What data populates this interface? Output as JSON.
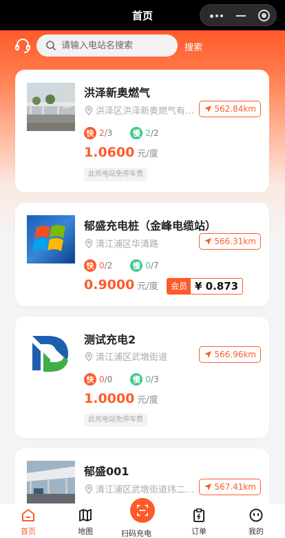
{
  "header": {
    "title": "首页"
  },
  "search": {
    "placeholder": "请输入电站名搜索",
    "value": "",
    "button": "搜索"
  },
  "stations": [
    {
      "name": "洪泽新奥燃气",
      "address": "洪泽区洪泽新奥燃气有…",
      "distance": "562.84km",
      "fast_label": "快",
      "fast_free": "2",
      "fast_total": "/3",
      "slow_label": "慢",
      "slow_free": "2",
      "slow_total": "/2",
      "price": "1.0600",
      "unit": "元/度",
      "tag": "此充电站免停车费"
    },
    {
      "name": "郁盛充电桩（金峰电缆站）",
      "address": "清江浦区华清路",
      "distance": "566.31km",
      "fast_label": "快",
      "fast_free": "0",
      "fast_total": "/2",
      "slow_label": "慢",
      "slow_free": "0",
      "slow_total": "/7",
      "price": "0.9000",
      "unit": "元/度",
      "member_label": "会员",
      "member_price": "¥ 0.873"
    },
    {
      "name": "测试充电2",
      "address": "清江浦区武墩街道",
      "distance": "566.96km",
      "fast_label": "快",
      "fast_free": "0",
      "fast_total": "/0",
      "slow_label": "慢",
      "slow_free": "0",
      "slow_total": "/3",
      "price": "1.0000",
      "unit": "元/度",
      "tag": "此充电站免停车费"
    },
    {
      "name": "郁盛001",
      "address": "清江浦区武墩街道纬二…",
      "distance": "567.41km"
    }
  ],
  "tabbar": {
    "home": "首页",
    "map": "地图",
    "scan": "扫码充电",
    "orders": "订单",
    "mine": "我的"
  },
  "colors": {
    "accent": "#ff5a2a",
    "slow": "#3ec98a"
  }
}
